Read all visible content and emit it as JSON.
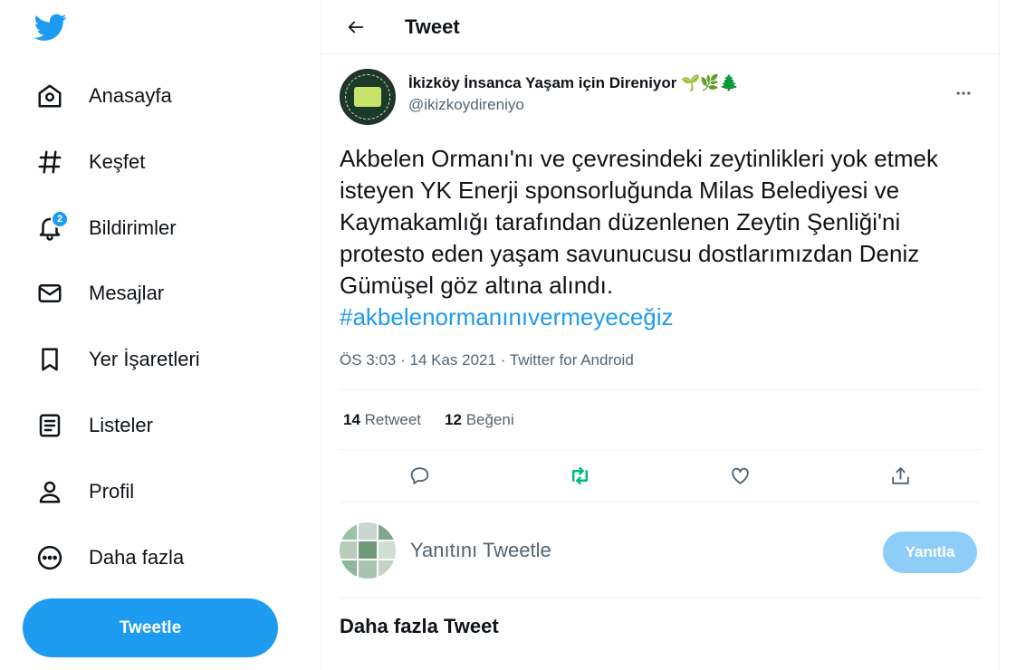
{
  "sidebar": {
    "items": [
      {
        "label": "Anasayfa",
        "icon": "home-icon"
      },
      {
        "label": "Keşfet",
        "icon": "hashtag-icon"
      },
      {
        "label": "Bildirimler",
        "icon": "bell-icon",
        "badge": "2"
      },
      {
        "label": "Mesajlar",
        "icon": "mail-icon"
      },
      {
        "label": "Yer İşaretleri",
        "icon": "bookmark-icon"
      },
      {
        "label": "Listeler",
        "icon": "list-icon"
      },
      {
        "label": "Profil",
        "icon": "person-icon"
      },
      {
        "label": "Daha fazla",
        "icon": "more-circle-icon"
      }
    ],
    "tweet_button": "Tweetle"
  },
  "header": {
    "title": "Tweet"
  },
  "tweet": {
    "author_name": "İkizköy İnsanca Yaşam için Direniyor 🌱🌿🌲",
    "author_handle": "@ikizkoydireniyo",
    "text": "Akbelen Ormanı'nı ve çevresindeki zeytinlikleri yok etmek isteyen YK Enerji sponsorluğunda Milas Belediyesi ve Kaymakamlığı tarafından düzenlenen Zeytin Şenliği'ni protesto eden yaşam savunucusu dostlarımızdan Deniz Gümüşel göz altına alındı.",
    "hashtag": "#akbelenormanınıvermeyeceğiz",
    "time": "ÖS 3:03",
    "date": "14 Kas 2021",
    "source": "Twitter for Android",
    "retweet_count": "14",
    "retweet_label": "Retweet",
    "like_count": "12",
    "like_label": "Beğeni"
  },
  "reply": {
    "placeholder": "Yanıtını Tweetle",
    "button": "Yanıtla"
  },
  "more_tweets_title": "Daha fazla Tweet",
  "colors": {
    "accent": "#1d9bf0",
    "retweet": "#00ba7c",
    "reply_button_disabled": "#8ecdf8"
  }
}
